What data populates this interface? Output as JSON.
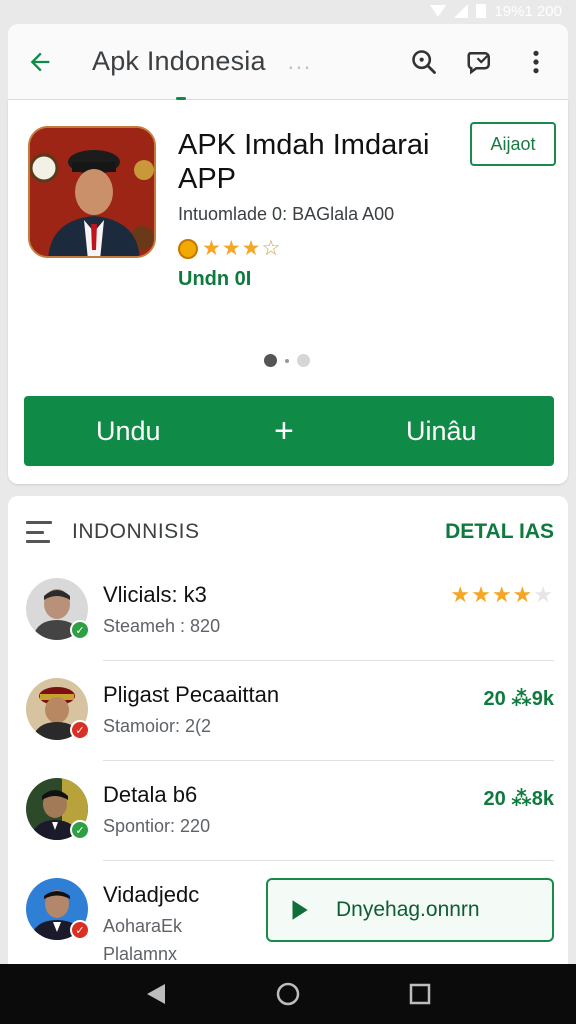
{
  "status": {
    "time": "19%1 200"
  },
  "app_bar": {
    "title": "Apk Indonesia",
    "extra_dots": "...",
    "icons": [
      "back-arrow-icon",
      "search-icon",
      "chat-icon",
      "more-vert-icon"
    ]
  },
  "detail": {
    "app_name": "APK Imdah Imdarai APP",
    "meta": "Intuomlade 0: BAGlala A00",
    "downloads": "Undn 0I",
    "follow_label": "Aijaot",
    "rating_stars": 3.5,
    "install": {
      "left_label": "Undu",
      "plus": "+",
      "right_label": "Uinâu"
    }
  },
  "list": {
    "section_title": "INDONNISIS",
    "section_link": "DETAL IAS",
    "rows": [
      {
        "title": "Vlicials: k3",
        "sub": "Steameh : 820",
        "stars": 4,
        "right": ""
      },
      {
        "title": "Pligast Pecaaittan",
        "sub": "Stamoior: 2(2",
        "right": "20 ⁂9k"
      },
      {
        "title": "Detala  b6",
        "sub": "Spontior: 220",
        "right": "20 ⁂8k"
      },
      {
        "title": "Vidadjedc",
        "sub": "AoharaEk",
        "sub2": "Plalamnx",
        "right": ""
      }
    ],
    "download_button": "Dnyehag.onnrn"
  },
  "colors": {
    "accent": "#0f8a47",
    "star": "#f5a623",
    "nav_bar": "#0b0b0b"
  }
}
